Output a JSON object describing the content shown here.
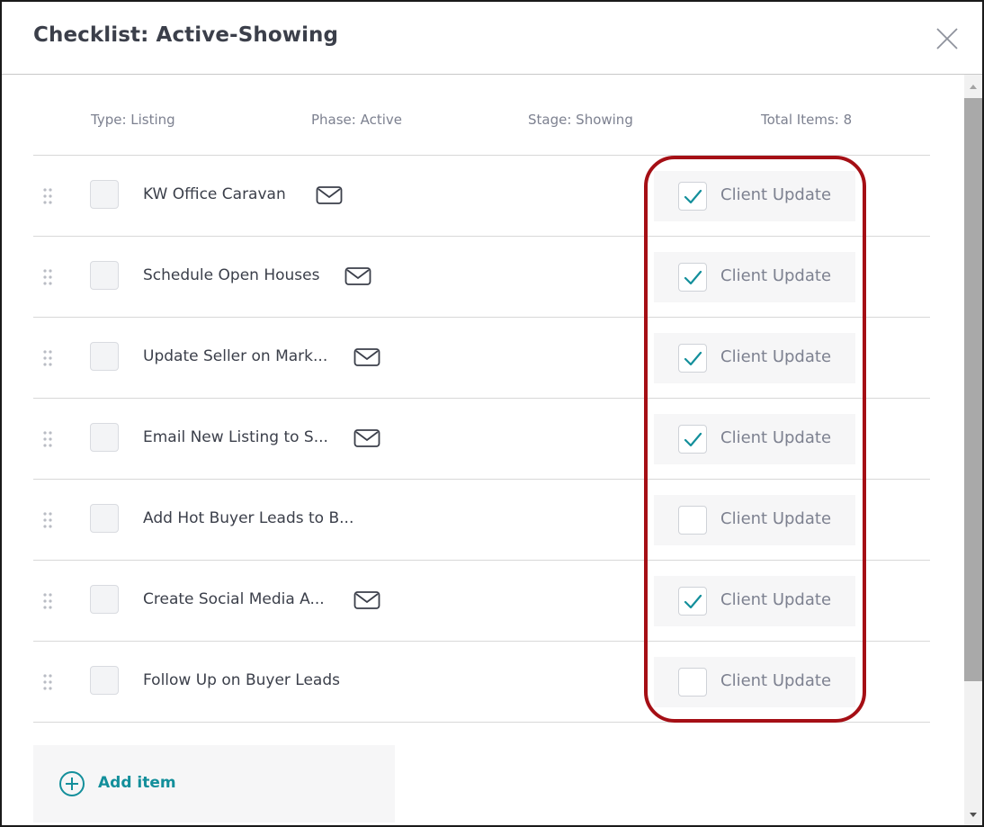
{
  "modal": {
    "title": "Checklist: Active-Showing"
  },
  "meta": {
    "type": "Type: Listing",
    "phase": "Phase: Active",
    "stage": "Stage: Showing",
    "total": "Total Items: 8"
  },
  "items": [
    {
      "label": "KW Office Caravan",
      "has_email": true,
      "client_update_label": "Client Update",
      "client_update_checked": true
    },
    {
      "label": "Schedule Open Houses",
      "has_email": true,
      "client_update_label": "Client Update",
      "client_update_checked": true
    },
    {
      "label": "Update Seller on Mark...",
      "has_email": true,
      "client_update_label": "Client Update",
      "client_update_checked": true
    },
    {
      "label": "Email New Listing to S...",
      "has_email": true,
      "client_update_label": "Client Update",
      "client_update_checked": true
    },
    {
      "label": "Add Hot Buyer Leads to B...",
      "has_email": false,
      "client_update_label": "Client Update",
      "client_update_checked": false
    },
    {
      "label": "Create Social Media A...",
      "has_email": true,
      "client_update_label": "Client Update",
      "client_update_checked": true
    },
    {
      "label": "Follow Up on Buyer Leads",
      "has_email": false,
      "client_update_label": "Client Update",
      "client_update_checked": false
    }
  ],
  "add_item": {
    "label": "Add item"
  },
  "icons": {
    "close": "close-icon",
    "drag": "drag-handle-icon",
    "mail": "mail-icon",
    "check": "checkmark-icon",
    "add": "plus-circle-icon"
  },
  "colors": {
    "accent": "#138f9b",
    "highlight": "#a50f15",
    "text": "#3b3f4a",
    "muted": "#7d8190"
  }
}
